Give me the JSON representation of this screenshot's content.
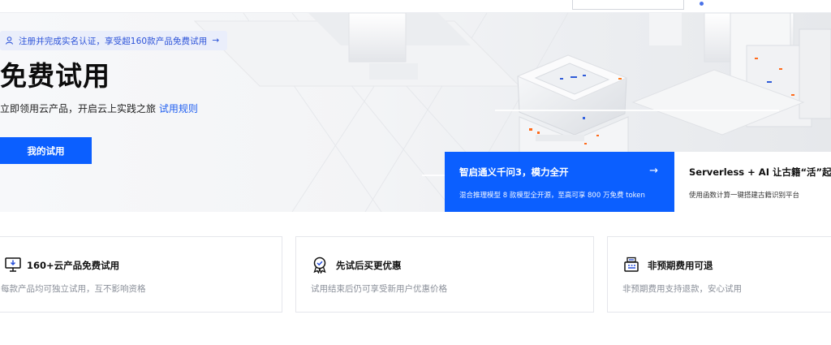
{
  "promo": {
    "text": "注册并完成实名认证，享受超160款产品免费试用",
    "arrow": "→"
  },
  "hero": {
    "title": "免费试用",
    "subtitle": "立即领用云产品，开启云上实践之旅",
    "rules_link": "试用规则",
    "my_trial_button": "我的试用"
  },
  "cards": [
    {
      "title": "智启通义千问3，模力全开",
      "desc": "混合推理模型 8 款模型全开源，至高可享 800 万免费 token",
      "arrow": "→"
    },
    {
      "title": "Serverless + AI 让古籍“活”起来",
      "desc": "使用函数计算一键搭建古籍识别平台"
    }
  ],
  "features": [
    {
      "icon": "monitor-download-icon",
      "title": "160+云产品免费试用",
      "desc": "每款产品均可独立试用，互不影响资格"
    },
    {
      "icon": "award-badge-icon",
      "title": "先试后买更优惠",
      "desc": "试用结束后仍可享受新用户优惠价格"
    },
    {
      "icon": "cash-register-icon",
      "title": "非预期费用可退",
      "desc": "非预期费用支持退款，安心试用"
    }
  ],
  "colors": {
    "brand_blue": "#0b5fff",
    "link_blue": "#1f5ef0",
    "pill_bg": "#eaeefb",
    "muted_text": "#8a8f99"
  }
}
